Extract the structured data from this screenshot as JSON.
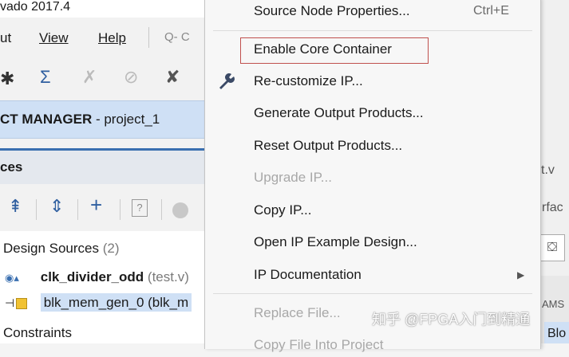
{
  "window_title": "vado 2017.4",
  "menubar": {
    "items": [
      "ut",
      "View",
      "Help"
    ],
    "search_hint": "Q- C"
  },
  "project_manager": {
    "label": "CT MANAGER",
    "project": " - project_1"
  },
  "sources": {
    "panel_title": "ces"
  },
  "tree": {
    "design_sources_label": "Design Sources",
    "design_sources_count": "(2)",
    "row1_name": "clk_divider_odd",
    "row1_file": "(test.v)",
    "row2_name": "blk_mem_gen_0 (blk_m",
    "constraints_label": "Constraints"
  },
  "context_menu": {
    "source_node_properties": "Source Node Properties...",
    "source_node_shortcut": "Ctrl+E",
    "enable_core_container": "Enable Core Container",
    "recustomize_ip": "Re-customize IP...",
    "generate_output_products": "Generate Output Products...",
    "reset_output_products": "Reset Output Products...",
    "upgrade_ip": "Upgrade IP...",
    "copy_ip": "Copy IP...",
    "open_ip_example": "Open IP Example Design...",
    "ip_documentation": "IP Documentation",
    "replace_file": "Replace File...",
    "copy_file_into_project": "Copy File Into Project"
  },
  "right_panel": {
    "tab": "t.v",
    "text1": "rfac",
    "text2": "AMS",
    "text3": "Blo"
  },
  "watermark": "知乎 @FPGA入门到精通",
  "colors": {
    "highlight_border": "#c0504d",
    "selection_bg": "#cfe0f5",
    "accent": "#3a6fb0"
  }
}
